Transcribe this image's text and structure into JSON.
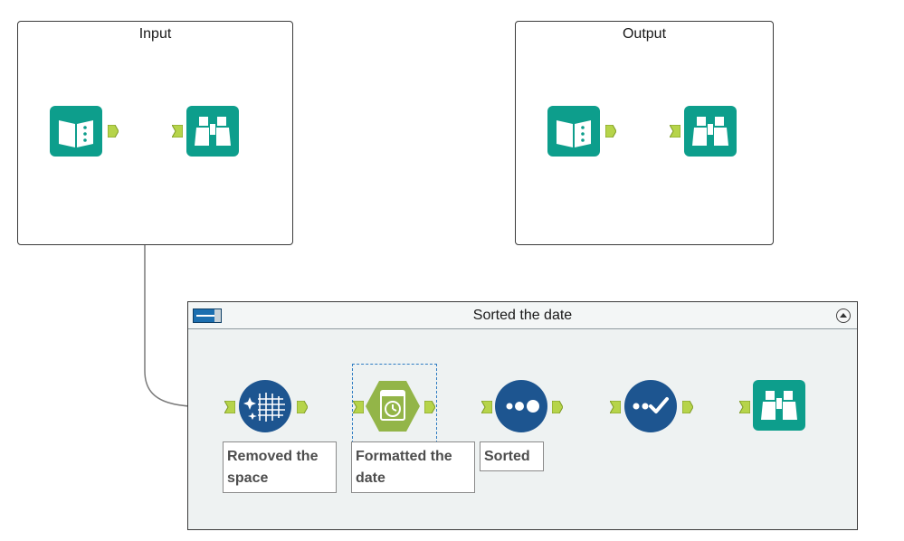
{
  "input_box": {
    "title": "Input"
  },
  "output_box": {
    "title": "Output"
  },
  "container": {
    "title": "Sorted the date"
  },
  "annotations": {
    "remove_space": "Removed the space",
    "format_date": "Formatted the date",
    "sort": "Sorted"
  },
  "colors": {
    "teal_tool": "#0d9e8c",
    "green_tool": "#93b548",
    "blue_tool": "#1d5590",
    "anchor": "#b6d44a",
    "connector": "#777777"
  }
}
